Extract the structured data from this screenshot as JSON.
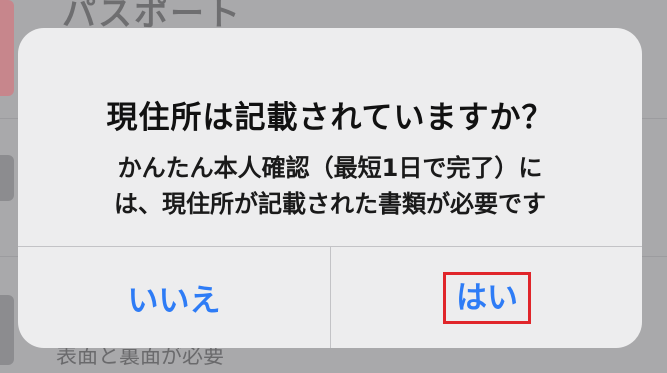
{
  "background": {
    "title_fragment": "パスポート",
    "subtext": "表面と裏面が必要"
  },
  "dialog": {
    "title": "現住所は記載されていますか？",
    "message_line1": "かんたん本人確認（最短1日で完了）に",
    "message_line2": "は、現住所が記載された書類が必要です",
    "no_label": "いいえ",
    "yes_label": "はい"
  },
  "colors": {
    "accent": "#2e7cf6",
    "highlight_border": "#e0252a"
  }
}
